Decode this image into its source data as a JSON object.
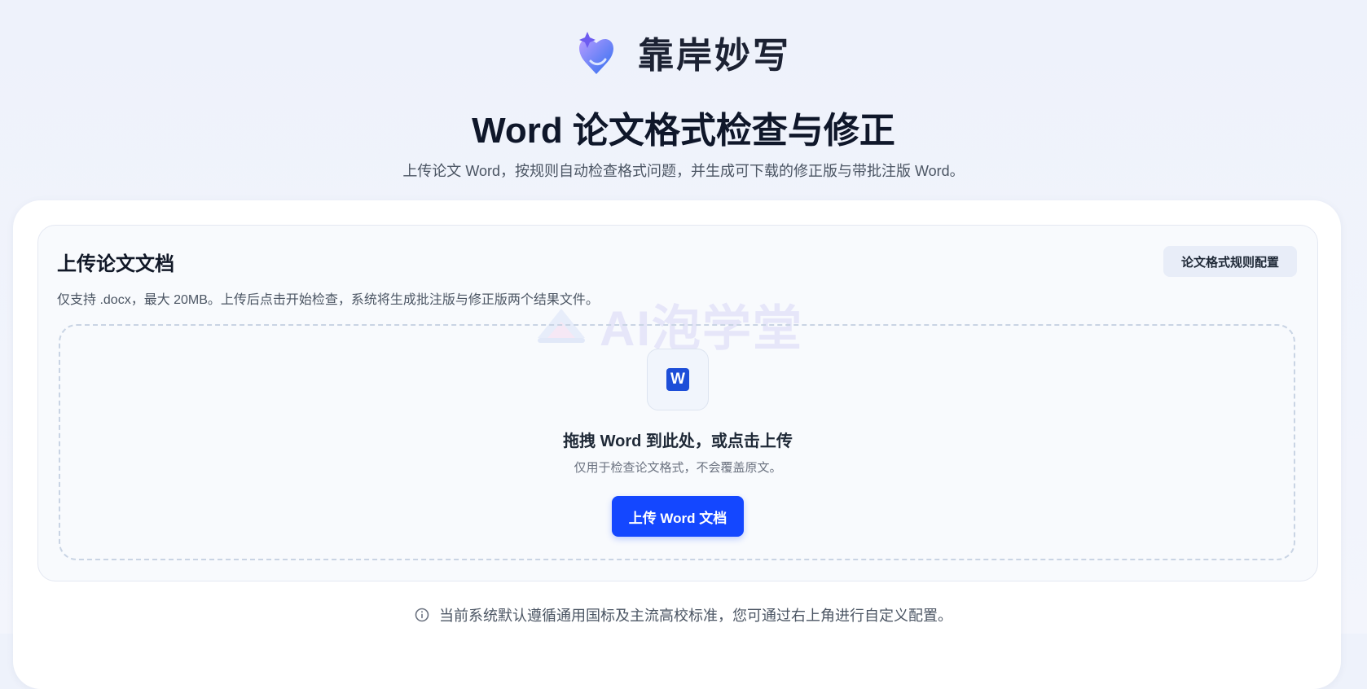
{
  "brand": {
    "name": "靠岸妙写",
    "logo_icon": "heart-sparkle-logo-icon"
  },
  "page": {
    "title": "Word 论文格式检查与修正",
    "subtitle": "上传论文 Word，按规则自动检查格式问题，并生成可下载的修正版与带批注版 Word。"
  },
  "upload_section": {
    "title": "上传论文文档",
    "description": "仅支持 .docx，最大 20MB。上传后点击开始检查，系统将生成批注版与修正版两个结果文件。",
    "rules_button_label": "论文格式规则配置",
    "watermark_text": "AI泡学堂",
    "dropzone": {
      "icon": "word-file-icon",
      "icon_letter": "W",
      "title": "拖拽 Word 到此处，或点击上传",
      "hint": "仅用于检查论文格式，不会覆盖原文。",
      "upload_button_label": "上传 Word 文档"
    }
  },
  "footer": {
    "icon": "info-icon",
    "note": "当前系统默认遵循通用国标及主流高校标准，您可通过右上角进行自定义配置。"
  },
  "colors": {
    "accent": "#1447ff",
    "word_icon": "#1d4ed8",
    "page_background": "#eef2fb",
    "brand_gradient_start": "#a78bfa",
    "brand_gradient_end": "#3b82f6"
  }
}
